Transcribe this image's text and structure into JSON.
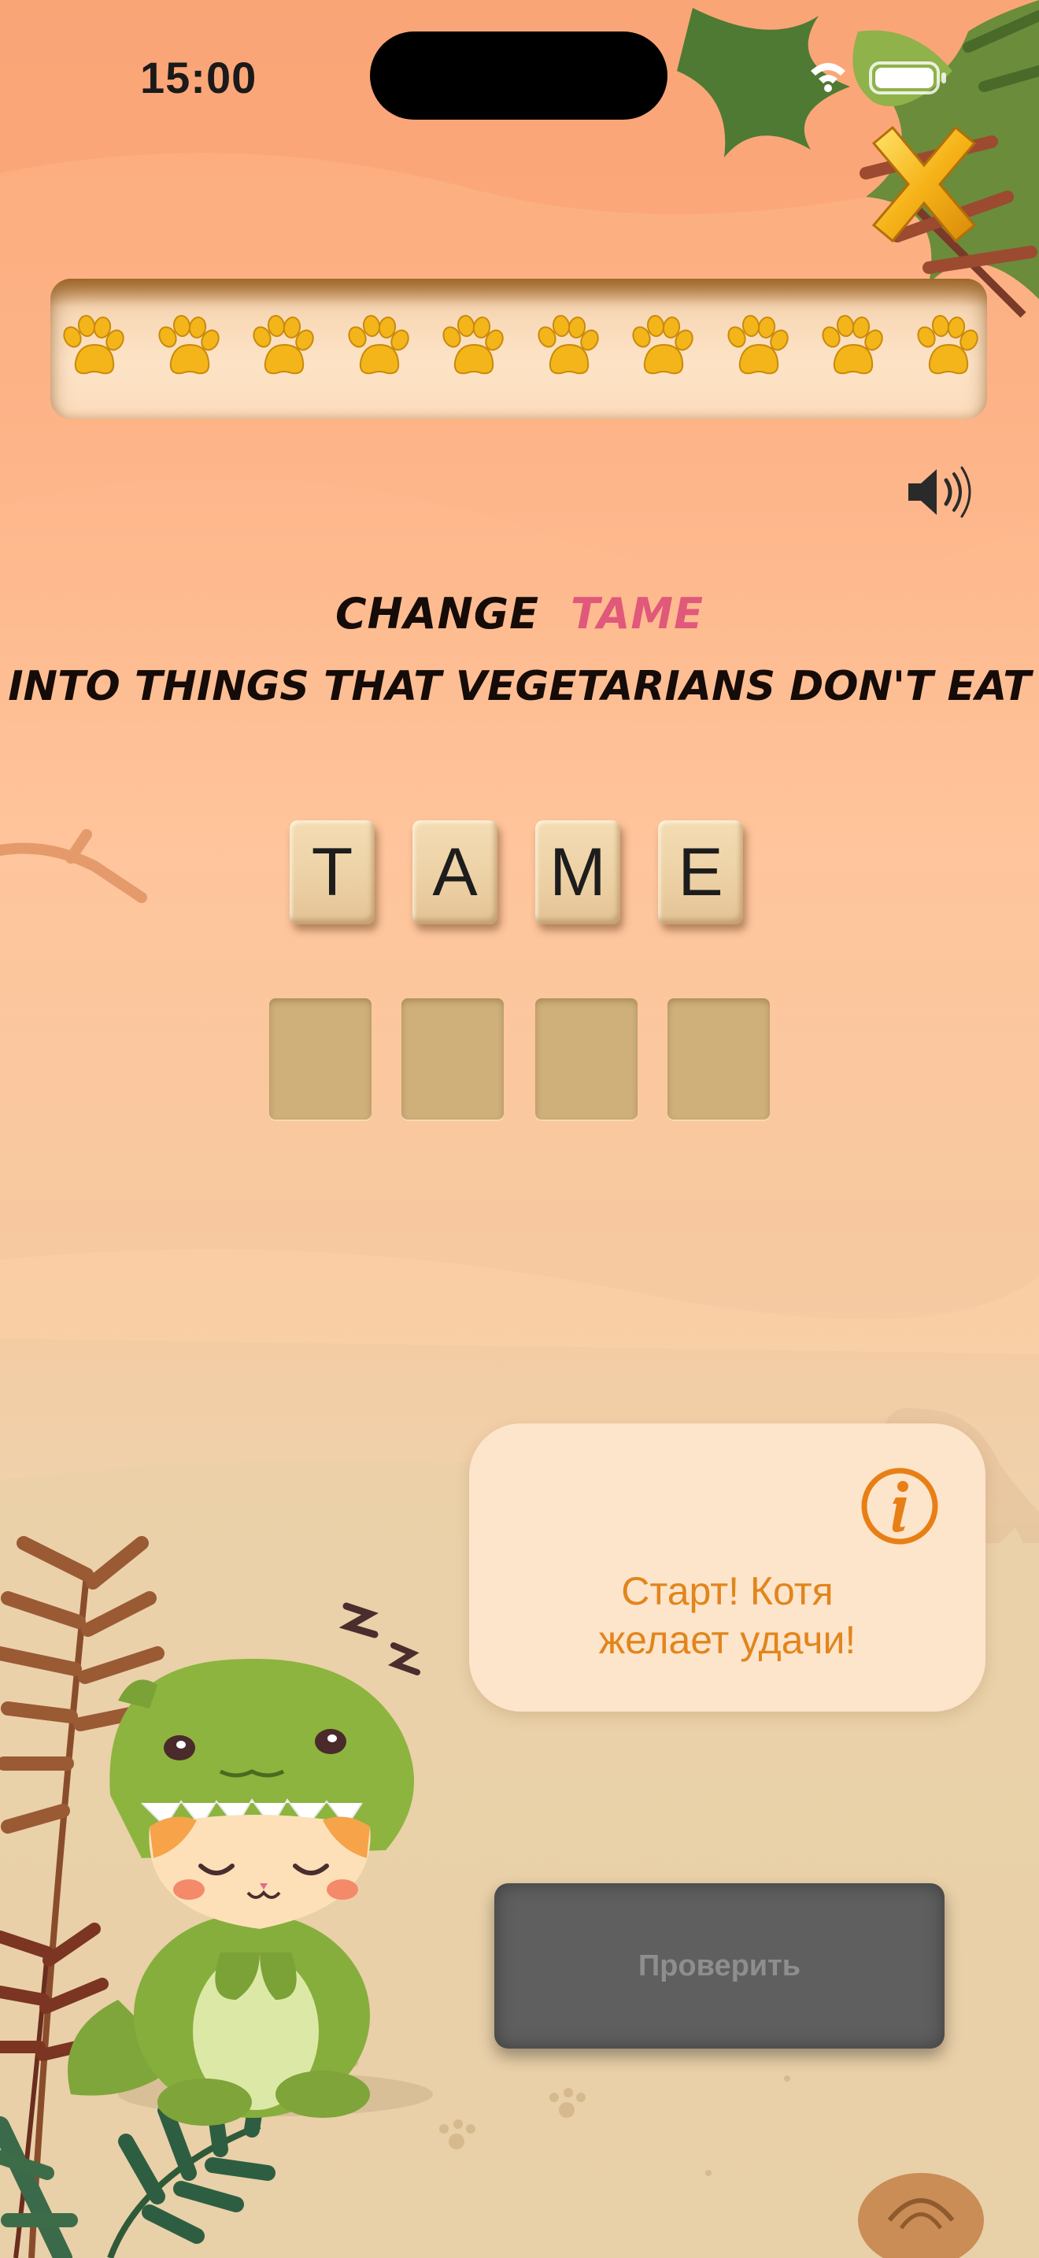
{
  "status": {
    "time": "15:00"
  },
  "progress": {
    "paws_total": 10,
    "paws_filled": 10
  },
  "prompt": {
    "change_label": "CHANGE",
    "source_word": "TAME",
    "instruction": "INTO THINGS THAT VEGETARIANS DON'T EAT"
  },
  "letter_tiles": [
    "T",
    "A",
    "M",
    "E"
  ],
  "answer_slots": [
    "",
    "",
    "",
    ""
  ],
  "hint": {
    "text_line1": "Старт! Котя",
    "text_line2": "желает удачи!"
  },
  "check_button": {
    "label": "Проверить"
  },
  "colors": {
    "accent_pink": "#e0587a",
    "hint_orange": "#e2851c",
    "paw_gold": "#f4b51a"
  },
  "icons": [
    "wifi-icon",
    "battery-icon",
    "close-x-icon",
    "paw-icon",
    "speaker-icon",
    "info-icon"
  ]
}
